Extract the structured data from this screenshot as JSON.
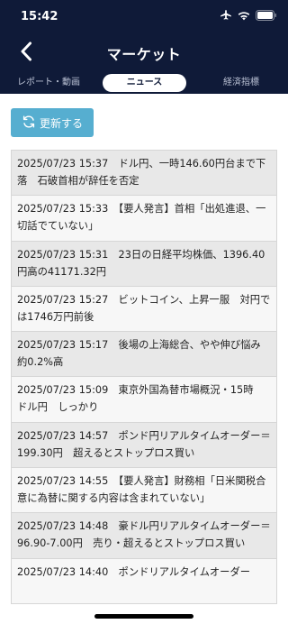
{
  "status": {
    "time": "15:42"
  },
  "header": {
    "title": "マーケット",
    "tabs": [
      {
        "label": "レポート・動画"
      },
      {
        "label": "ニュース"
      },
      {
        "label": "経済指標"
      }
    ]
  },
  "toolbar": {
    "refresh_label": "更新する"
  },
  "news": [
    {
      "text": "2025/07/23 15:37　ドル円、一時146.60円台まで下落　石破首相が辞任を否定"
    },
    {
      "text": "2025/07/23 15:33　【要人発言】首相「出処進退、一切話でていない」"
    },
    {
      "text": "2025/07/23 15:31　23日の日経平均株価、1396.40円高の41171.32円"
    },
    {
      "text": "2025/07/23 15:27　ビットコイン、上昇一服　対円では1746万円前後"
    },
    {
      "text": "2025/07/23 15:17　後場の上海総合、やや伸び悩み　約0.2%高"
    },
    {
      "text": "2025/07/23 15:09　東京外国為替市場概況・15時　ドル円　しっかり"
    },
    {
      "text": "2025/07/23 14:57　ポンド円リアルタイムオーダー＝199.30円　超えるとストップロス買い"
    },
    {
      "text": "2025/07/23 14:55　【要人発言】財務相「日米関税合意に為替に関する内容は含まれていない」"
    },
    {
      "text": "2025/07/23 14:48　豪ドル円リアルタイムオーダー＝96.90-7.00円　売り・超えるとストップロス買い"
    },
    {
      "text": "2025/07/23 14:40　ポンドリアルタイムオーダー"
    }
  ]
}
